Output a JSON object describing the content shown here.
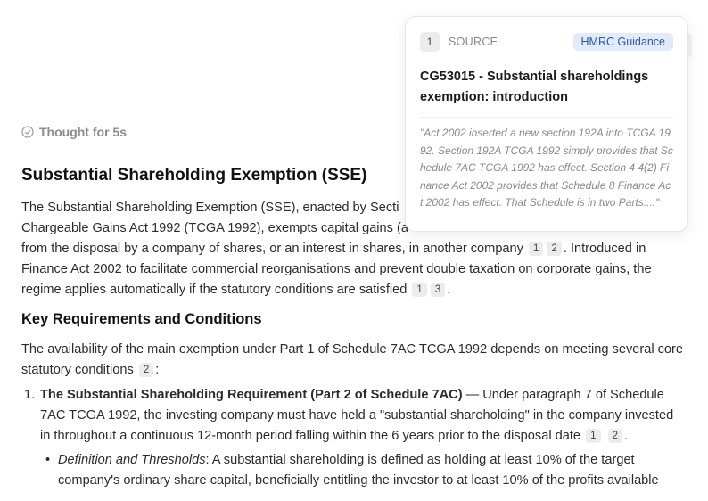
{
  "thought": {
    "label": "Thought for 5s"
  },
  "heading": "Substantial Shareholding Exemption (SSE)",
  "intro": {
    "text1": "The Substantial Shareholding Exemption (SSE), enacted by Secti",
    "text1b": "Chargeable Gains Act 1992 (TCGA 1992), exempts capital gains (a",
    "text2": "from the disposal by a company of shares, or an interest in shares, in another company",
    "text3": ". Introduced in Finance Act 2002 to facilitate commercial reorganisations and prevent double taxation on corporate gains, the regime applies automatically if the statutory conditions are satisfied",
    "text4": "."
  },
  "citations": {
    "c1": "1",
    "c2": "2",
    "c3": "3"
  },
  "section_heading": "Key Requirements and Conditions",
  "availability": {
    "text1": "The availability of the main exemption under Part 1 of Schedule 7AC TCGA 1992 depends on meeting several core statutory conditions",
    "text2": ":"
  },
  "list": {
    "item1": {
      "num": "1.",
      "title": "The Substantial Shareholding Requirement (Part 2 of Schedule 7AC)",
      "body": " — Under paragraph 7 of Schedule 7AC TCGA 1992, the investing company must have held a \"substantial shareholding\" in the company invested in throughout a continuous 12-month period falling within the 6 years prior to the disposal date",
      "end": "."
    },
    "sub1": {
      "bullet": "•",
      "title": "Definition and Thresholds",
      "body": ": A substantial shareholding is defined as holding at least 10% of the target company's ordinary share capital, beneficially entitling the investor to at least 10% of the profits available"
    }
  },
  "popup": {
    "index": "1",
    "source_label": "SOURCE",
    "badge": "HMRC Guidance",
    "title": "CG53015 - Substantial shareholdings exemption: introduction",
    "quote": "\"Act 2002 inserted a new section 192A into TCGA 1992. Section 192A TCGA 1992 simply provides that Schedule 7AC TCGA 1992 has effect. Section 4 4(2) Finance Act 2002 provides that Schedule 8 Finance Act 2002 has effect. That Schedule is in two Parts:...\""
  },
  "colors": {
    "badge_bg": "#e1ebfb",
    "badge_text": "#2c5aa0",
    "citation_bg": "#ececec"
  },
  "icons": {
    "thought": "check-circle-icon"
  }
}
